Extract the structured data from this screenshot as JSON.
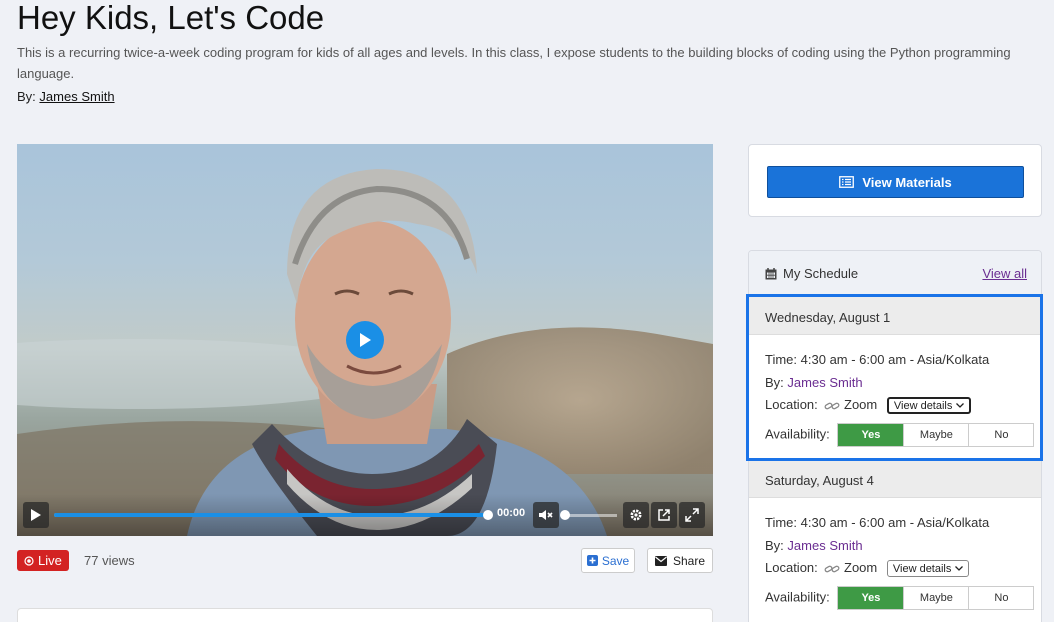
{
  "course": {
    "title": "Hey Kids, Let's Code",
    "description": "This is a recurring twice-a-week coding program for kids of all ages and levels. In this class, I expose students to the building blocks of coding using the Python programming language.",
    "by_label": "By:",
    "instructor": "James Smith"
  },
  "video": {
    "time": "00:00",
    "progress": 1.0,
    "volume": 0.0,
    "accent": "#1a8fe6"
  },
  "meta": {
    "live_label": "Live",
    "views": "77 views",
    "save_label": "Save",
    "share_label": "Share"
  },
  "materials": {
    "button_label": "View Materials"
  },
  "schedule": {
    "title": "My Schedule",
    "view_all": "View all",
    "days": [
      {
        "date": "Wednesday, August 1",
        "time_label": "Time:",
        "time": "4:30 am - 6:00 am - Asia/Kolkata",
        "by_label": "By:",
        "by": "James Smith",
        "location_label": "Location:",
        "location": "Zoom",
        "details_label": "View details",
        "availability_label": "Availability:",
        "options": [
          "Yes",
          "Maybe",
          "No"
        ],
        "selected": "Yes"
      },
      {
        "date": "Saturday, August 4",
        "time_label": "Time:",
        "time": "4:30 am - 6:00 am - Asia/Kolkata",
        "by_label": "By:",
        "by": "James Smith",
        "location_label": "Location:",
        "location": "Zoom",
        "details_label": "View details",
        "availability_label": "Availability:",
        "options": [
          "Yes",
          "Maybe",
          "No"
        ],
        "selected": "Yes"
      }
    ]
  },
  "colors": {
    "primary": "#1a73d9",
    "live": "#d32222",
    "yes_selected": "#3e9a45",
    "link_purple": "#6a2d91",
    "highlight": "#1a73e8"
  },
  "icons": {
    "save": "plus-square-icon",
    "share": "envelope-icon",
    "materials": "list-icon",
    "schedule": "calendar-icon",
    "location": "link-icon"
  }
}
